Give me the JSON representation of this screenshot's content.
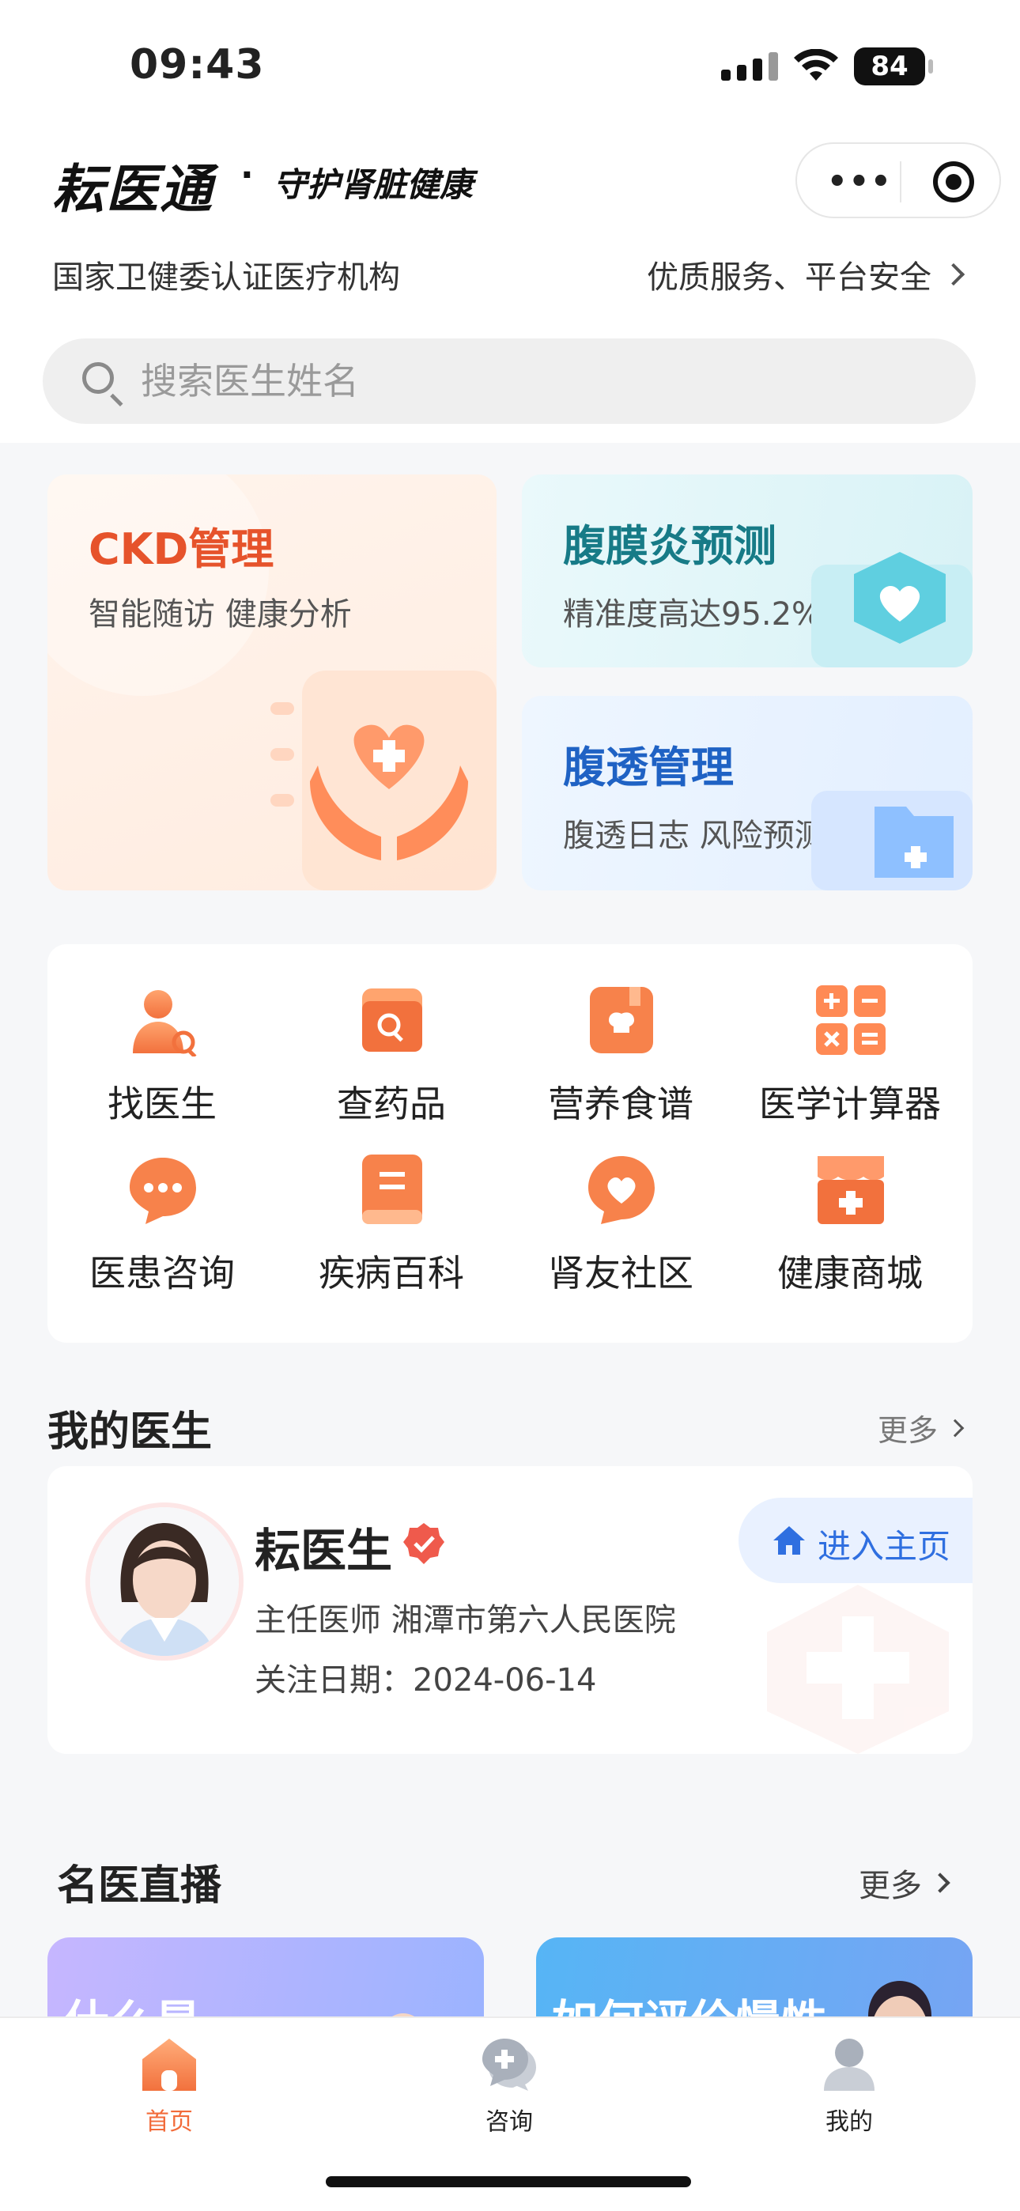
{
  "status_bar": {
    "time": "09:43",
    "battery": "84"
  },
  "header": {
    "brand": "耘医通",
    "dot": "·",
    "slogan": "守护肾脏健康",
    "cert_text": "国家卫健委认证医疗机构",
    "service_text": "优质服务、平台安全",
    "capsule_more": "•••"
  },
  "search": {
    "placeholder": "搜索医生姓名"
  },
  "features": {
    "ckd": {
      "title": "CKD管理",
      "subtitle": "智能随访 健康分析"
    },
    "peritonitis": {
      "title": "腹膜炎预测",
      "subtitle": "精准度高达95.2%"
    },
    "pd": {
      "title": "腹透管理",
      "subtitle": "腹透日志 风险预测"
    }
  },
  "grid": [
    {
      "label": "找医生",
      "icon": "find-doctor-icon"
    },
    {
      "label": "查药品",
      "icon": "drug-search-icon"
    },
    {
      "label": "营养食谱",
      "icon": "recipe-icon"
    },
    {
      "label": "医学计算器",
      "icon": "calculator-icon"
    },
    {
      "label": "医患咨询",
      "icon": "chat-icon"
    },
    {
      "label": "疾病百科",
      "icon": "book-icon"
    },
    {
      "label": "肾友社区",
      "icon": "community-heart-icon"
    },
    {
      "label": "健康商城",
      "icon": "shop-icon"
    }
  ],
  "my_doctor": {
    "section_title": "我的医生",
    "more": "更多",
    "name": "耘医生",
    "title_hospital": "主任医师 湘潭市第六人民医院",
    "follow_date": "关注日期：2024-06-14",
    "enter_button": "进入主页"
  },
  "live": {
    "section_title": "名医直播",
    "more": "更多",
    "cards": [
      {
        "text": "什么是"
      },
      {
        "text": "如何评价慢性"
      }
    ]
  },
  "tabbar": [
    {
      "label": "首页",
      "icon": "home-icon",
      "active": true
    },
    {
      "label": "咨询",
      "icon": "consult-icon",
      "active": false
    },
    {
      "label": "我的",
      "icon": "profile-icon",
      "active": false
    }
  ],
  "colors": {
    "accent": "#f26b3a",
    "ckd_title": "#e6532b",
    "peritonitis_title": "#177b87",
    "pd_title": "#1f62c4",
    "link_blue": "#2f6fe0"
  }
}
